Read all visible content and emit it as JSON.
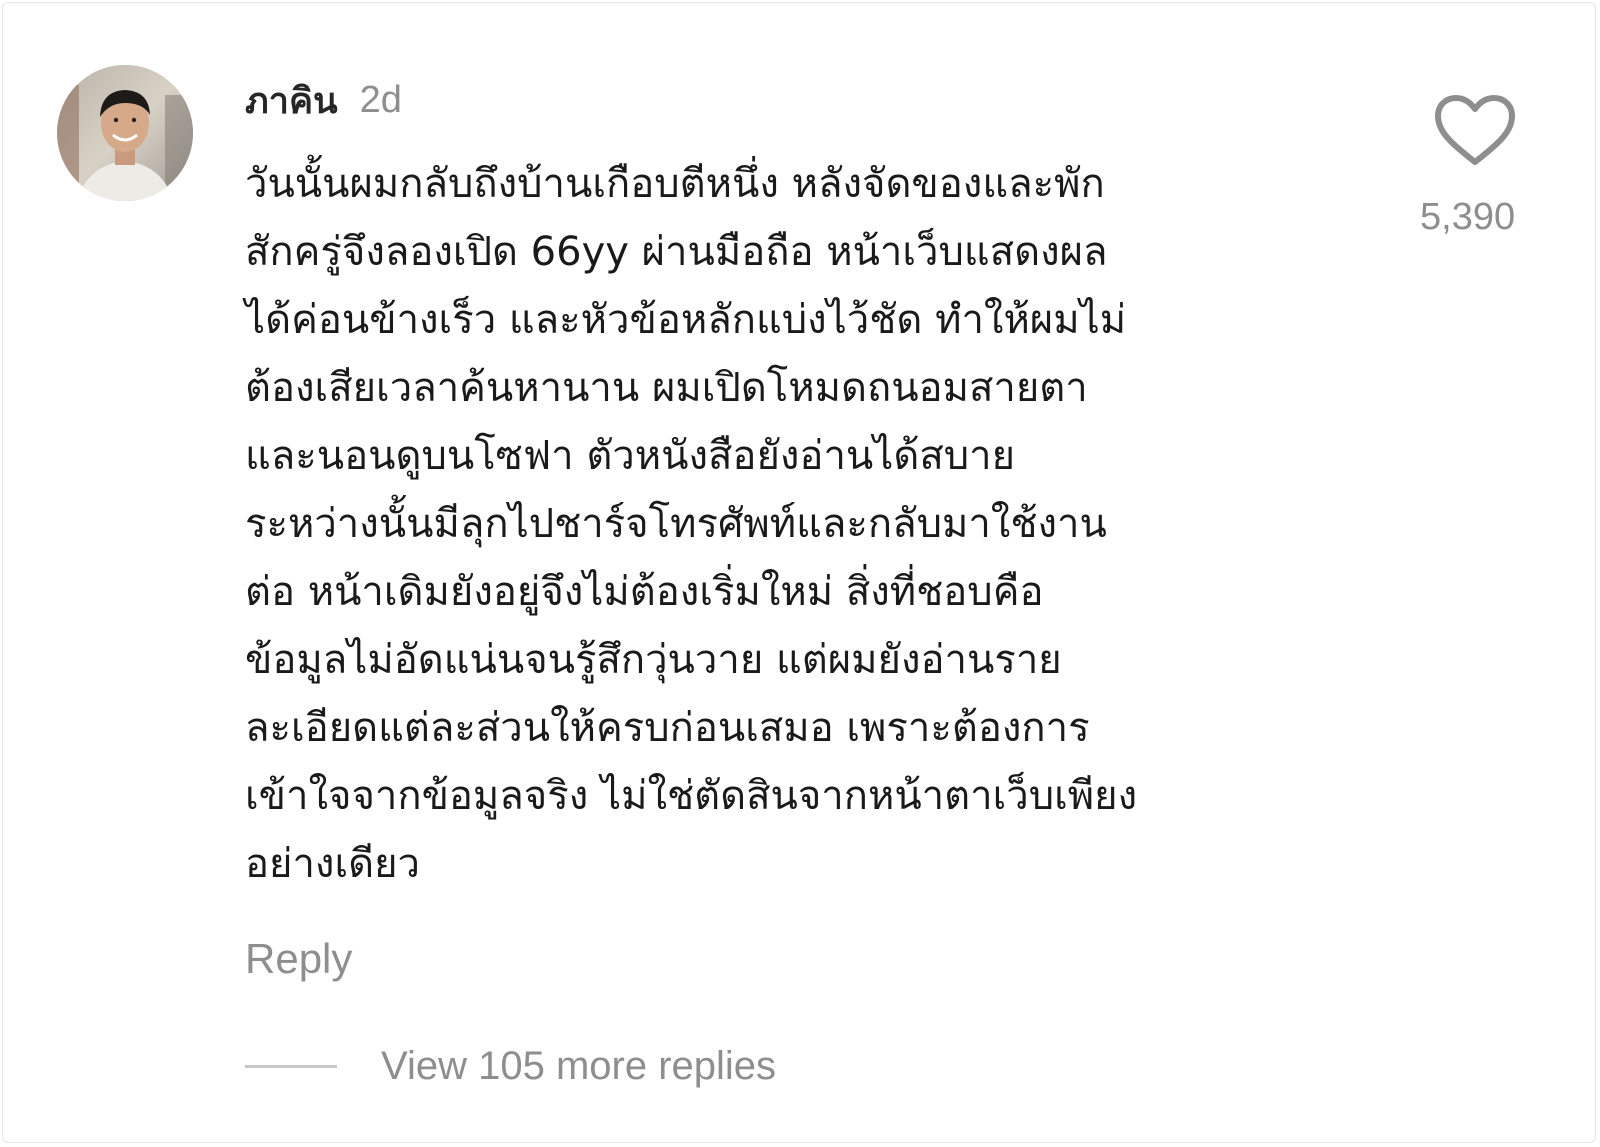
{
  "comment": {
    "username": "ภาคิน",
    "time": "2d",
    "text_lines": [
      "วันนั้นผมกลับถึงบ้านเกือบตีหนึ่ง หลังจัดของและพัก",
      "สักครู่จึงลองเปิด 66yy ผ่านมือถือ หน้าเว็บแสดงผล",
      "ได้ค่อนข้างเร็ว และหัวข้อหลักแบ่งไว้ชัด ทำให้ผมไม่",
      "ต้องเสียเวลาค้นหานาน ผมเปิดโหมดถนอมสายตา",
      "และนอนดูบนโซฟา ตัวหนังสือยังอ่านได้สบาย",
      "ระหว่างนั้นมีลุกไปชาร์จโทรศัพท์และกลับมาใช้งาน",
      "ต่อ หน้าเดิมยังอยู่จึงไม่ต้องเริ่มใหม่ สิ่งที่ชอบคือ",
      "ข้อมูลไม่อัดแน่นจนรู้สึกวุ่นวาย แต่ผมยังอ่านราย",
      "ละเอียดแต่ละส่วนให้ครบก่อนเสมอ เพราะต้องการ",
      "เข้าใจจากข้อมูลจริง ไม่ใช่ตัดสินจากหน้าตาเว็บเพียง",
      "อย่างเดียว"
    ],
    "like_icon": "heart-outline-icon",
    "like_count": "5,390",
    "reply_label": "Reply",
    "view_replies_label": "View 105 more replies"
  },
  "colors": {
    "primary_text": "#262626",
    "secondary_text": "#8e8e8e",
    "divider": "#c7c7c7"
  }
}
